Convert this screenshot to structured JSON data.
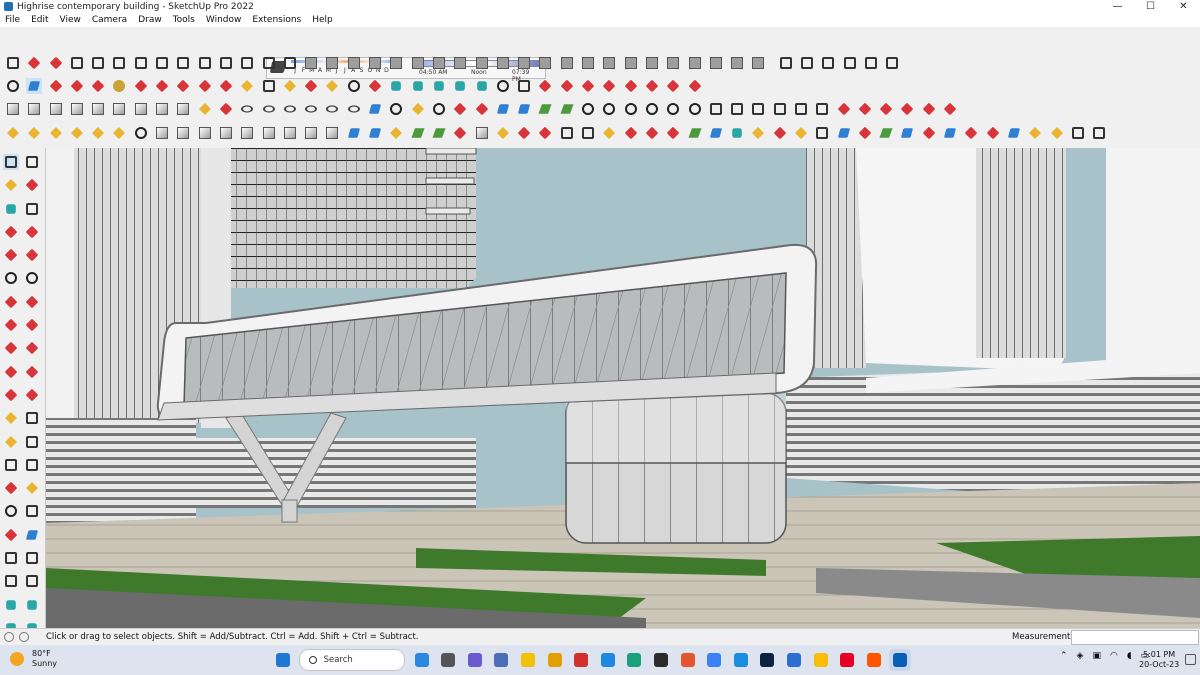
{
  "window": {
    "title": "Highrise contemporary building - SketchUp Pro 2022",
    "minimize": "—",
    "maximize": "☐",
    "close": "✕"
  },
  "menu": [
    "File",
    "Edit",
    "View",
    "Camera",
    "Draw",
    "Tools",
    "Window",
    "Extensions",
    "Help"
  ],
  "shadow_settings": {
    "months": [
      "J",
      "F",
      "M",
      "A",
      "M",
      "J",
      "J",
      "A",
      "S",
      "O",
      "N",
      "D"
    ],
    "time_start": "04:50 AM",
    "time_noon": "Noon",
    "time_end": "07:39 PM"
  },
  "status": {
    "message": "Click or drag to select objects. Shift = Add/Subtract. Ctrl = Add. Shift + Ctrl = Subtract.",
    "measurements_label": "Measurements",
    "measurements_value": ""
  },
  "taskbar": {
    "weather_temp": "80°F",
    "weather_desc": "Sunny",
    "search_placeholder": "Search",
    "time": "5:01 PM",
    "date": "20-Oct-23"
  },
  "colors": {
    "accent": "#2f7fd2",
    "sky": "#a5c1c7",
    "grass": "#3f7a2c",
    "paving": "#c9c3b6"
  }
}
